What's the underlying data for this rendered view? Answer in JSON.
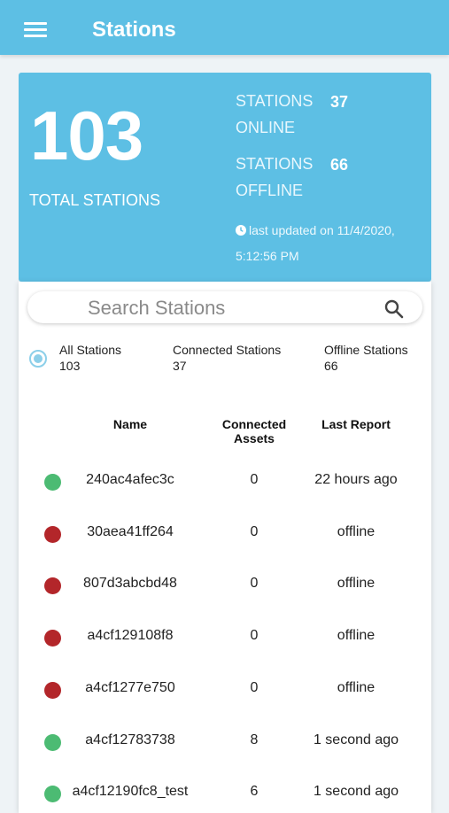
{
  "header": {
    "title": "Stations"
  },
  "summary": {
    "total_value": "103",
    "total_label": "TOTAL STATIONS",
    "online_label_1": "STATIONS",
    "online_label_2": "ONLINE",
    "online_value": "37",
    "offline_label_1": "STATIONS",
    "offline_label_2": "OFFLINE",
    "offline_value": "66",
    "updated_line_1": "last updated on 11/4/2020,",
    "updated_line_2": "5:12:56 PM"
  },
  "search": {
    "placeholder": "Search Stations"
  },
  "filters": {
    "all": {
      "label": "All Stations",
      "count": "103",
      "selected": true
    },
    "connected": {
      "label": "Connected Stations",
      "count": "37"
    },
    "offline": {
      "label": "Offline Stations",
      "count": "66"
    }
  },
  "table": {
    "columns": [
      "Name",
      "Connected Assets",
      "Last Report"
    ],
    "rows": [
      {
        "status": "online",
        "name": "240ac4afec3c",
        "assets": "0",
        "last_report": "22 hours ago"
      },
      {
        "status": "offline",
        "name": "30aea41ff264",
        "assets": "0",
        "last_report": "offline"
      },
      {
        "status": "offline",
        "name": "807d3abcbd48",
        "assets": "0",
        "last_report": "offline"
      },
      {
        "status": "offline",
        "name": "a4cf129108f8",
        "assets": "0",
        "last_report": "offline"
      },
      {
        "status": "offline",
        "name": "a4cf1277e750",
        "assets": "0",
        "last_report": "offline"
      },
      {
        "status": "online",
        "name": "a4cf12783738",
        "assets": "8",
        "last_report": "1 second ago"
      },
      {
        "status": "online",
        "name": "a4cf12190fc8_test",
        "assets": "6",
        "last_report": "1 second ago"
      }
    ]
  },
  "colors": {
    "accent": "#5dbfe4",
    "online": "#4cbb73",
    "offline": "#b3262a"
  }
}
